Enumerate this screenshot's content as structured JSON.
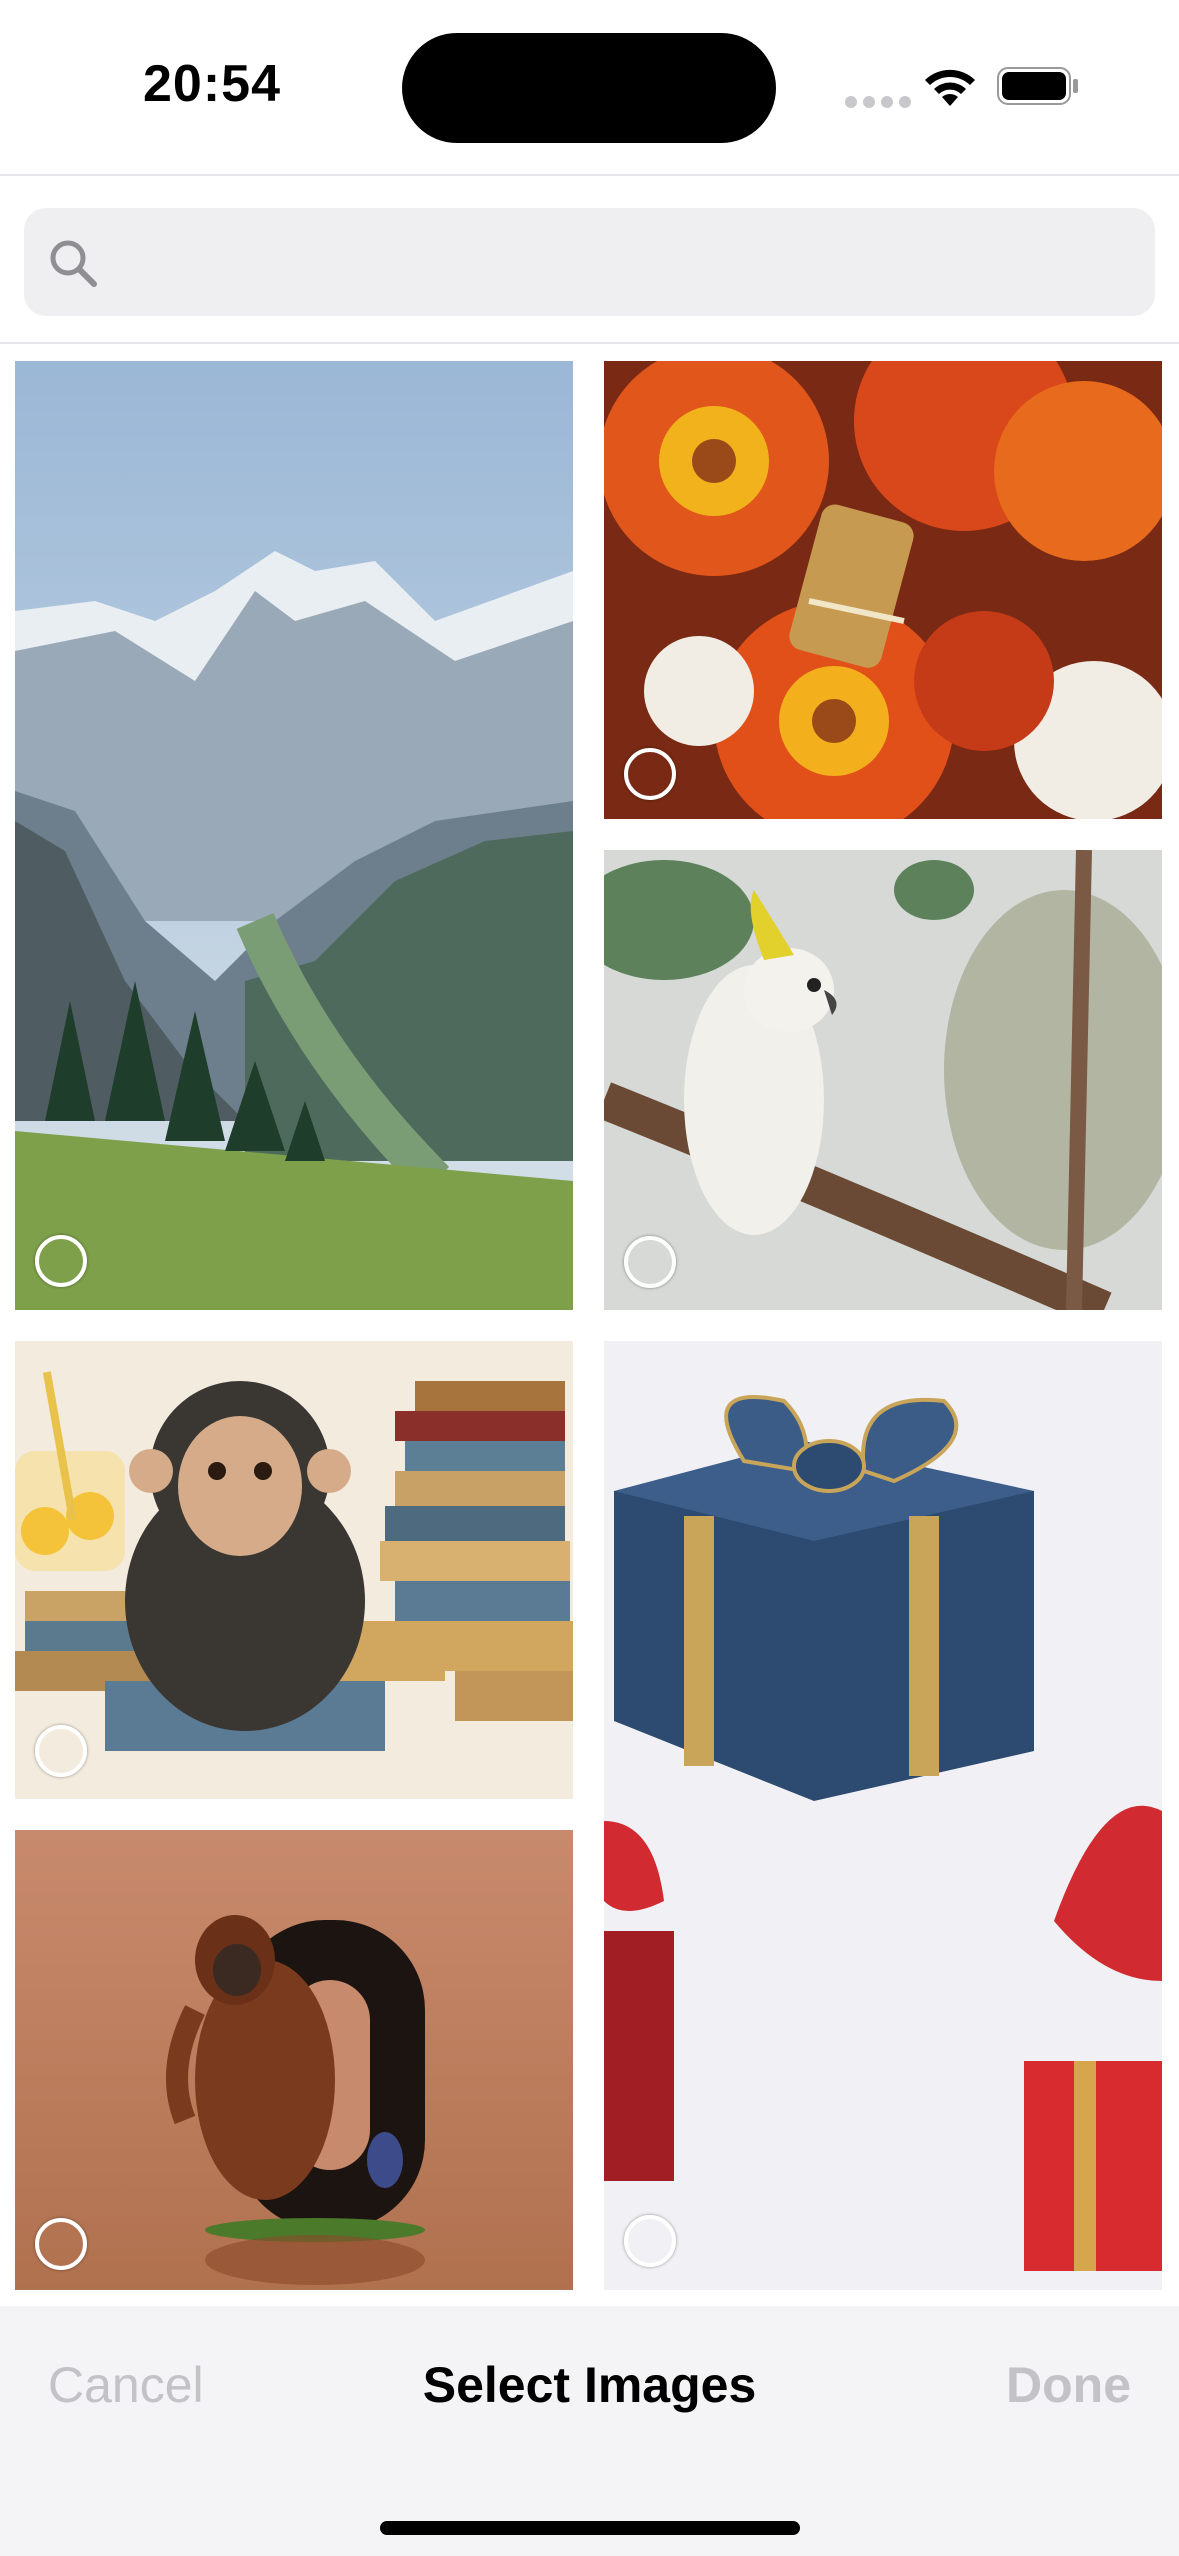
{
  "status_bar": {
    "time": "20:54",
    "icons": [
      "cellular-signal-icon",
      "wifi-icon",
      "battery-icon"
    ]
  },
  "search": {
    "placeholder": "",
    "value": "",
    "icon": "search-icon"
  },
  "images": [
    {
      "subject": "mountain-valley",
      "selected": false
    },
    {
      "subject": "orange-chrysanthemums",
      "selected": false
    },
    {
      "subject": "white-cockatoo",
      "selected": false
    },
    {
      "subject": "chimpanzee-with-books",
      "selected": false
    },
    {
      "subject": "blue-and-red-gift-boxes",
      "selected": false
    },
    {
      "subject": "orangutan-number-zero",
      "selected": false
    }
  ],
  "navigation": {
    "cancel_label": "Cancel",
    "title": "Select Images",
    "done_label": "Done"
  },
  "colors": {
    "disabled_text": "#c2c2c7",
    "bar_background": "#f4f4f6",
    "search_background": "#efeff2"
  }
}
